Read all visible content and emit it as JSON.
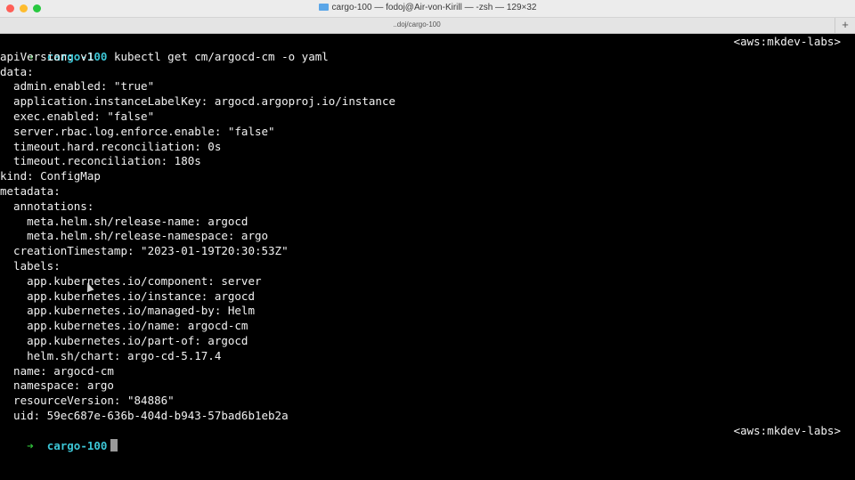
{
  "window": {
    "title": "cargo-100 — fodoj@Air-von-Kirill — -zsh — 129×32",
    "tab_title": "..doj/cargo-100",
    "new_tab_label": "+"
  },
  "prompt": {
    "arrow": "➜",
    "dir": "cargo-100",
    "right_prompt": "<aws:mkdev-labs>"
  },
  "command": "kubectl get cm/argocd-cm -o yaml",
  "output": [
    "apiVersion: v1",
    "data:",
    "  admin.enabled: \"true\"",
    "  application.instanceLabelKey: argocd.argoproj.io/instance",
    "  exec.enabled: \"false\"",
    "  server.rbac.log.enforce.enable: \"false\"",
    "  timeout.hard.reconciliation: 0s",
    "  timeout.reconciliation: 180s",
    "kind: ConfigMap",
    "metadata:",
    "  annotations:",
    "    meta.helm.sh/release-name: argocd",
    "    meta.helm.sh/release-namespace: argo",
    "  creationTimestamp: \"2023-01-19T20:30:53Z\"",
    "  labels:",
    "    app.kubernetes.io/component: server",
    "    app.kubernetes.io/instance: argocd",
    "    app.kubernetes.io/managed-by: Helm",
    "    app.kubernetes.io/name: argocd-cm",
    "    app.kubernetes.io/part-of: argocd",
    "    helm.sh/chart: argo-cd-5.17.4",
    "  name: argocd-cm",
    "  namespace: argo",
    "  resourceVersion: \"84886\"",
    "  uid: 59ec687e-636b-404d-b943-57bad6b1eb2a"
  ]
}
